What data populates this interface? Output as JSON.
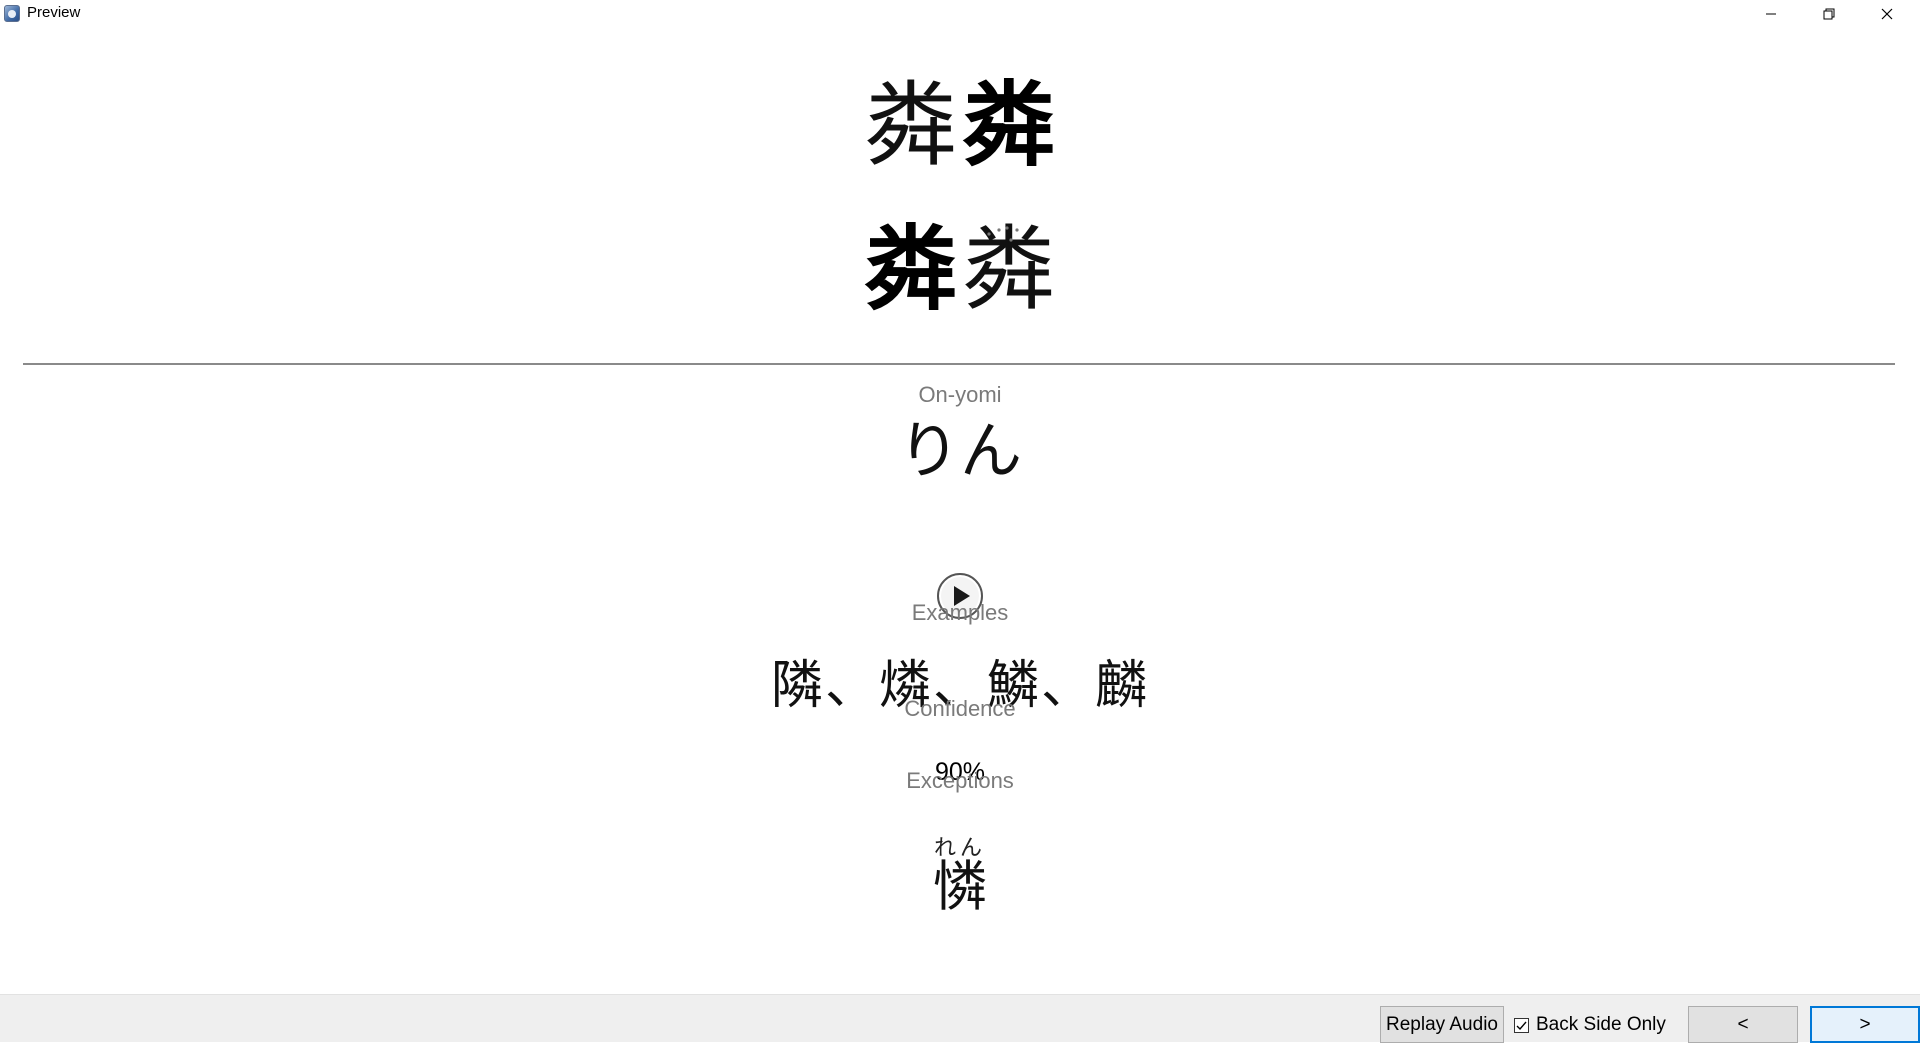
{
  "window": {
    "title": "Preview",
    "icon": "app-icon",
    "controls": [
      "minimize-icon",
      "restore-icon",
      "close-icon"
    ]
  },
  "card": {
    "kanji_row_1": [
      "粦",
      "粦"
    ],
    "kanji_row_2": [
      "粦",
      "粦"
    ],
    "onyomi_label": "On-yomi",
    "onyomi": "りん",
    "examples_label": "Examples",
    "examples": "隣、燐、鱗、麟",
    "confidence_label": "Confidence",
    "confidence": "90%",
    "exceptions_label": "Exceptions",
    "exception_reading": "れん",
    "exception_kanji": "憐"
  },
  "toolbar": {
    "replay_label": "Replay Audio",
    "back_side_only_label": "Back Side Only",
    "back_side_only_checked": true,
    "prev_label": "<",
    "next_label": ">"
  }
}
